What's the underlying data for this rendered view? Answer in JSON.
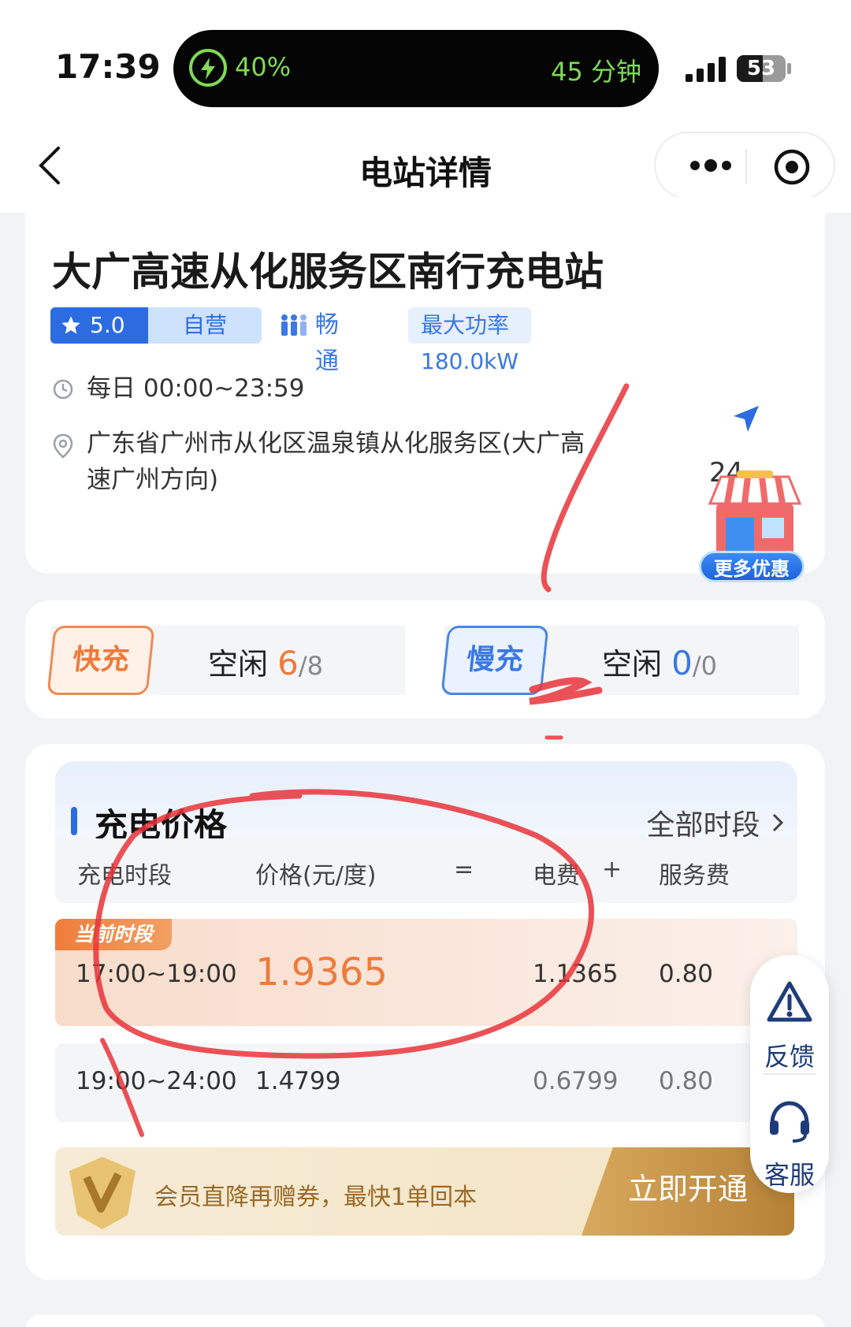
{
  "status_bar": {
    "time": "17:39",
    "charge_percent": "40%",
    "charge_time": "45 分钟",
    "battery_level": "53"
  },
  "nav": {
    "title": "电站详情"
  },
  "station": {
    "name": "大广高速从化服务区南行充电站",
    "rating": "5.0",
    "operation": "自营",
    "traffic": "畅通",
    "max_power": "最大功率180.0kW",
    "hours": "每日 00:00~23:59",
    "address": "广东省广州市从化区温泉镇从化服务区(大广高速广州方向)",
    "distance": "24",
    "promo_label": "更多优惠"
  },
  "availability": {
    "fast": {
      "label": "快充",
      "status": "空闲",
      "free": "6",
      "total": "/8"
    },
    "slow": {
      "label": "慢充",
      "status": "空闲",
      "free": "0",
      "total": "/0"
    }
  },
  "pricing": {
    "title": "充电价格",
    "all_periods": "全部时段",
    "columns": {
      "period": "充电时段",
      "price": "价格(元/度)",
      "equals": "=",
      "electricity": "电费",
      "plus": "+",
      "service": "服务费"
    },
    "current_badge": "当前时段",
    "rows": [
      {
        "period": "17:00~19:00",
        "price": "1.9365",
        "electricity": "1.1365",
        "service": "0.80"
      },
      {
        "period": "19:00~24:00",
        "price": "1.4799",
        "electricity": "0.6799",
        "service": "0.80"
      }
    ]
  },
  "member": {
    "text": "会员直降再赠券，最快1单回本",
    "button": "立即开通"
  },
  "side_panel": {
    "feedback": "反馈",
    "support": "客服"
  },
  "colors": {
    "accent_blue": "#2c6ce0",
    "accent_orange": "#ee7a3a",
    "annotation_red": "#e8343a"
  }
}
